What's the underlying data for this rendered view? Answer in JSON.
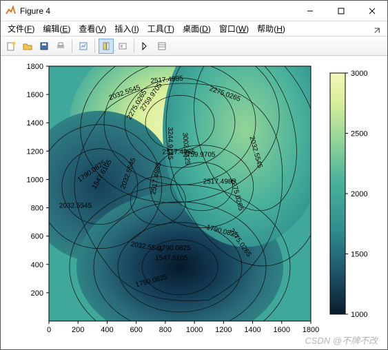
{
  "window": {
    "title": "Figure 4",
    "buttons": {
      "min": "min",
      "max": "max",
      "close": "close"
    }
  },
  "menu": {
    "file": {
      "label": "文件",
      "key": "F"
    },
    "edit": {
      "label": "编辑",
      "key": "E"
    },
    "view": {
      "label": "查看",
      "key": "V"
    },
    "insert": {
      "label": "插入",
      "key": "I"
    },
    "tools": {
      "label": "工具",
      "key": "T"
    },
    "desktop": {
      "label": "桌面",
      "key": "D"
    },
    "window": {
      "label": "窗口",
      "key": "W"
    },
    "help": {
      "label": "帮助",
      "key": "H"
    }
  },
  "toolbar": {
    "new": "new",
    "open": "open",
    "save": "save",
    "print": "print",
    "brush": "brush",
    "ruler": "ruler",
    "dock1": "dock1",
    "dock2": "dock2",
    "arrow": "arrow",
    "prop": "prop"
  },
  "chart_data": {
    "type": "heatmap",
    "title": "",
    "xlabel": "",
    "ylabel": "",
    "xlim": [
      0,
      1800
    ],
    "ylim": [
      0,
      1800
    ],
    "x_ticks": [
      0,
      200,
      400,
      600,
      800,
      1000,
      1200,
      1400,
      1600,
      1800
    ],
    "y_ticks": [
      200,
      400,
      600,
      800,
      1000,
      1200,
      1400,
      1600,
      1800
    ],
    "colorbar_range": [
      1000,
      3000
    ],
    "colorbar_ticks": [
      1000,
      1500,
      2000,
      2500,
      3000
    ],
    "contour_levels": [
      1547.6105,
      1790.0825,
      2032.5545,
      2275.0265,
      2517.4985,
      2759.9705,
      3002.4425,
      3244.9145
    ],
    "contour_label_text": [
      "2032.5545",
      "2032.5545",
      "2517.4985",
      "2275.0265",
      "2759.9705",
      "2275.0265",
      "2032.5545",
      "1790.0825",
      "1547.6105",
      "2032.5545",
      "2032.5545",
      "2517.4985",
      "2759.9705",
      "3002.4425",
      "3244.9145",
      "2275.0265",
      "2517.4985",
      "2032.5545",
      "2517.4985",
      "1790.0825",
      "2032.5545",
      "1547.6105",
      "1790.0825",
      "2275.0265"
    ]
  },
  "watermark": "CSDN @不牌不改"
}
